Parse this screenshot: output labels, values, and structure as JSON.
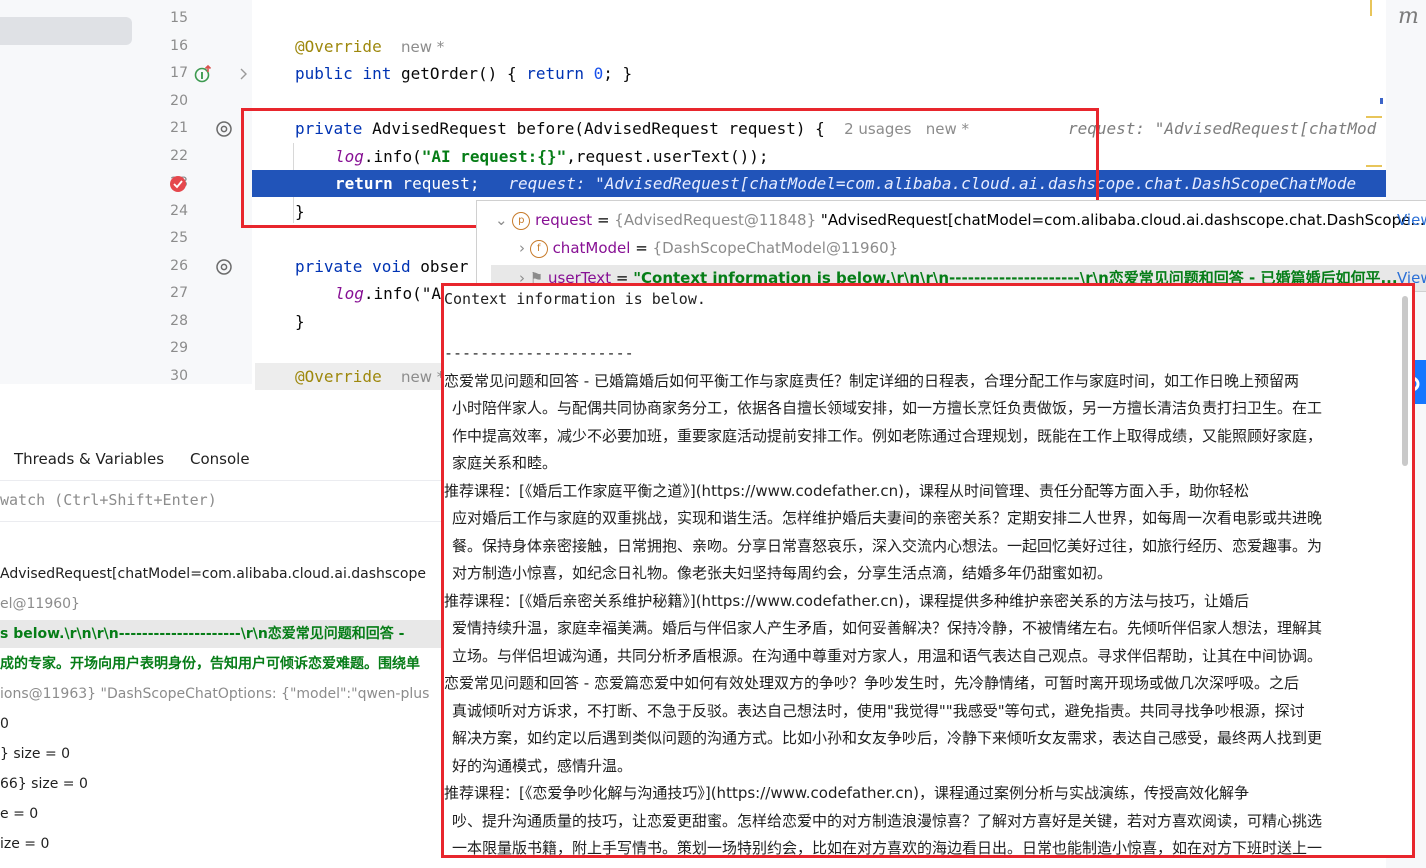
{
  "gutter": {
    "line_numbers": [
      "15",
      "16",
      "17",
      "20",
      "21",
      "22",
      "23",
      "24",
      "25",
      "26",
      "27",
      "28",
      "29",
      "30"
    ]
  },
  "code": {
    "l16_annotation": "@Override",
    "l16_hint": "new *",
    "l17_kw1": "public",
    "l17_kw2": "int",
    "l17_text": " getOrder() { ",
    "l17_kw3": "return",
    "l17_num": "0",
    "l17_end": "; }",
    "l21_kw": "private",
    "l21_text": " AdvisedRequest before(AdvisedRequest request) {",
    "l21_hint": "2 usages   new *",
    "l21_inline": "request: \"AdvisedRequest[chatMod",
    "l22_fld": "log",
    "l22_text": ".info(",
    "l22_str": "\"AI request:{}\"",
    "l22_end": ",request.userText());",
    "l23_kw": "return",
    "l23_text": " request;",
    "l23_inline": "request: \"AdvisedRequest[chatModel=com.alibaba.cloud.ai.dashscope.chat.DashScopeChatMode",
    "l24_text": "}",
    "l26_kw1": "private",
    "l26_kw2": "void",
    "l26_text": " obser",
    "l27_fld": "log",
    "l27_text": ".info(\"A",
    "l28_text": "}",
    "l30_annotation": "@Override",
    "l30_hint": "new *"
  },
  "right_edge": {
    "letter": "m"
  },
  "debugger": {
    "tabs": [
      "Threads & Variables",
      "Console"
    ],
    "watch_placeholder": "watch (Ctrl+Shift+Enter)",
    "rows": [
      "AdvisedRequest[chatModel=com.alibaba.cloud.ai.dashscope",
      "el@11960}",
      "s below.\\r\\n\\r\\n---------------------\\r\\n恋爱常见问题和回答 -",
      "成的专家。开场向用户表明身份，告知用户可倾诉恋爱难题。围绕单",
      "ions@11963} \"DashScopeChatOptions: {\"model\":\"qwen-plus",
      "0",
      "} size = 0",
      "66} size = 0",
      "e = 0",
      "ize = 0"
    ]
  },
  "popup": {
    "row1_name": "request",
    "row1_eq": " = ",
    "row1_ref": "{AdvisedRequest@11848}",
    "row1_val": " \"AdvisedRequest[chatModel=com.alibaba.cloud.ai.dashscope.chat.DashScope...",
    "row1_view": "View",
    "row2_name": "chatModel",
    "row2_eq": " = ",
    "row2_ref": "{DashScopeChatModel@11960}",
    "row3_name": "userText",
    "row3_eq": " = ",
    "row3_val": "\"Context information is below.\\r\\n\\r\\n---------------------\\r\\n恋爱常见问题和回答 - 已婚篇婚后如何平...",
    "row3_view": "View"
  },
  "text_popup": {
    "lines": [
      "Context information is below.",
      "",
      "---------------------",
      "恋爱常见问题和回答 - 已婚篇婚后如何平衡工作与家庭责任？制定详细的日程表，合理分配工作与家庭时间，如工作日晚上预留两",
      "小时陪伴家人。与配偶共同协商家务分工，依据各自擅长领域安排，如一方擅长烹饪负责做饭，另一方擅长清洁负责打扫卫生。在工",
      "作中提高效率，减少不必要加班，重要家庭活动提前安排工作。例如老陈通过合理规划，既能在工作上取得成绩，又能照顾好家庭，",
      "家庭关系和睦。",
      "推荐课程：[《婚后工作家庭平衡之道》](https://www.codefather.cn)，课程从时间管理、责任分配等方面入手，助你轻松",
      "应对婚后工作与家庭的双重挑战，实现和谐生活。怎样维护婚后夫妻间的亲密关系？定期安排二人世界，如每周一次看电影或共进晚",
      "餐。保持身体亲密接触，日常拥抱、亲吻。分享日常喜怒哀乐，深入交流内心想法。一起回忆美好过往，如旅行经历、恋爱趣事。为",
      "对方制造小惊喜，如纪念日礼物。像老张夫妇坚持每周约会，分享生活点滴，结婚多年仍甜蜜如初。",
      "推荐课程：[《婚后亲密关系维护秘籍》](https://www.codefather.cn)，课程提供多种维护亲密关系的方法与技巧，让婚后",
      "爱情持续升温，家庭幸福美满。婚后与伴侣家人产生矛盾，如何妥善解决？保持冷静，不被情绪左右。先倾听伴侣家人想法，理解其",
      "立场。与伴侣坦诚沟通，共同分析矛盾根源。在沟通中尊重对方家人，用温和语气表达自己观点。寻求伴侣帮助，让其在中间协调。",
      "恋爱常见问题和回答 - 恋爱篇恋爱中如何有效处理双方的争吵？争吵发生时，先冷静情绪，可暂时离开现场或做几次深呼吸。之后",
      "真诚倾听对方诉求，不打断、不急于反驳。表达自己想法时，使用\"我觉得\"\"我感受\"等句式，避免指责。共同寻找争吵根源，探讨",
      "解决方案，如约定以后遇到类似问题的沟通方式。比如小孙和女友争吵后，冷静下来倾听女友需求，表达自己感受，最终两人找到更",
      "好的沟通模式，感情升温。",
      "推荐课程：[《恋爱争吵化解与沟通技巧》](https://www.codefather.cn)，课程通过案例分析与实战演练，传授高效化解争",
      "吵、提升沟通质量的技巧，让恋爱更甜蜜。怎样给恋爱中的对方制造浪漫惊喜？了解对方喜好是关键，若对方喜欢阅读，可精心挑选",
      "一本限量版书籍，附上手写情书。策划一场特别约会，比如在对方喜欢的海边看日出。日常也能制造小惊喜，如在对方下班时送上一"
    ]
  }
}
